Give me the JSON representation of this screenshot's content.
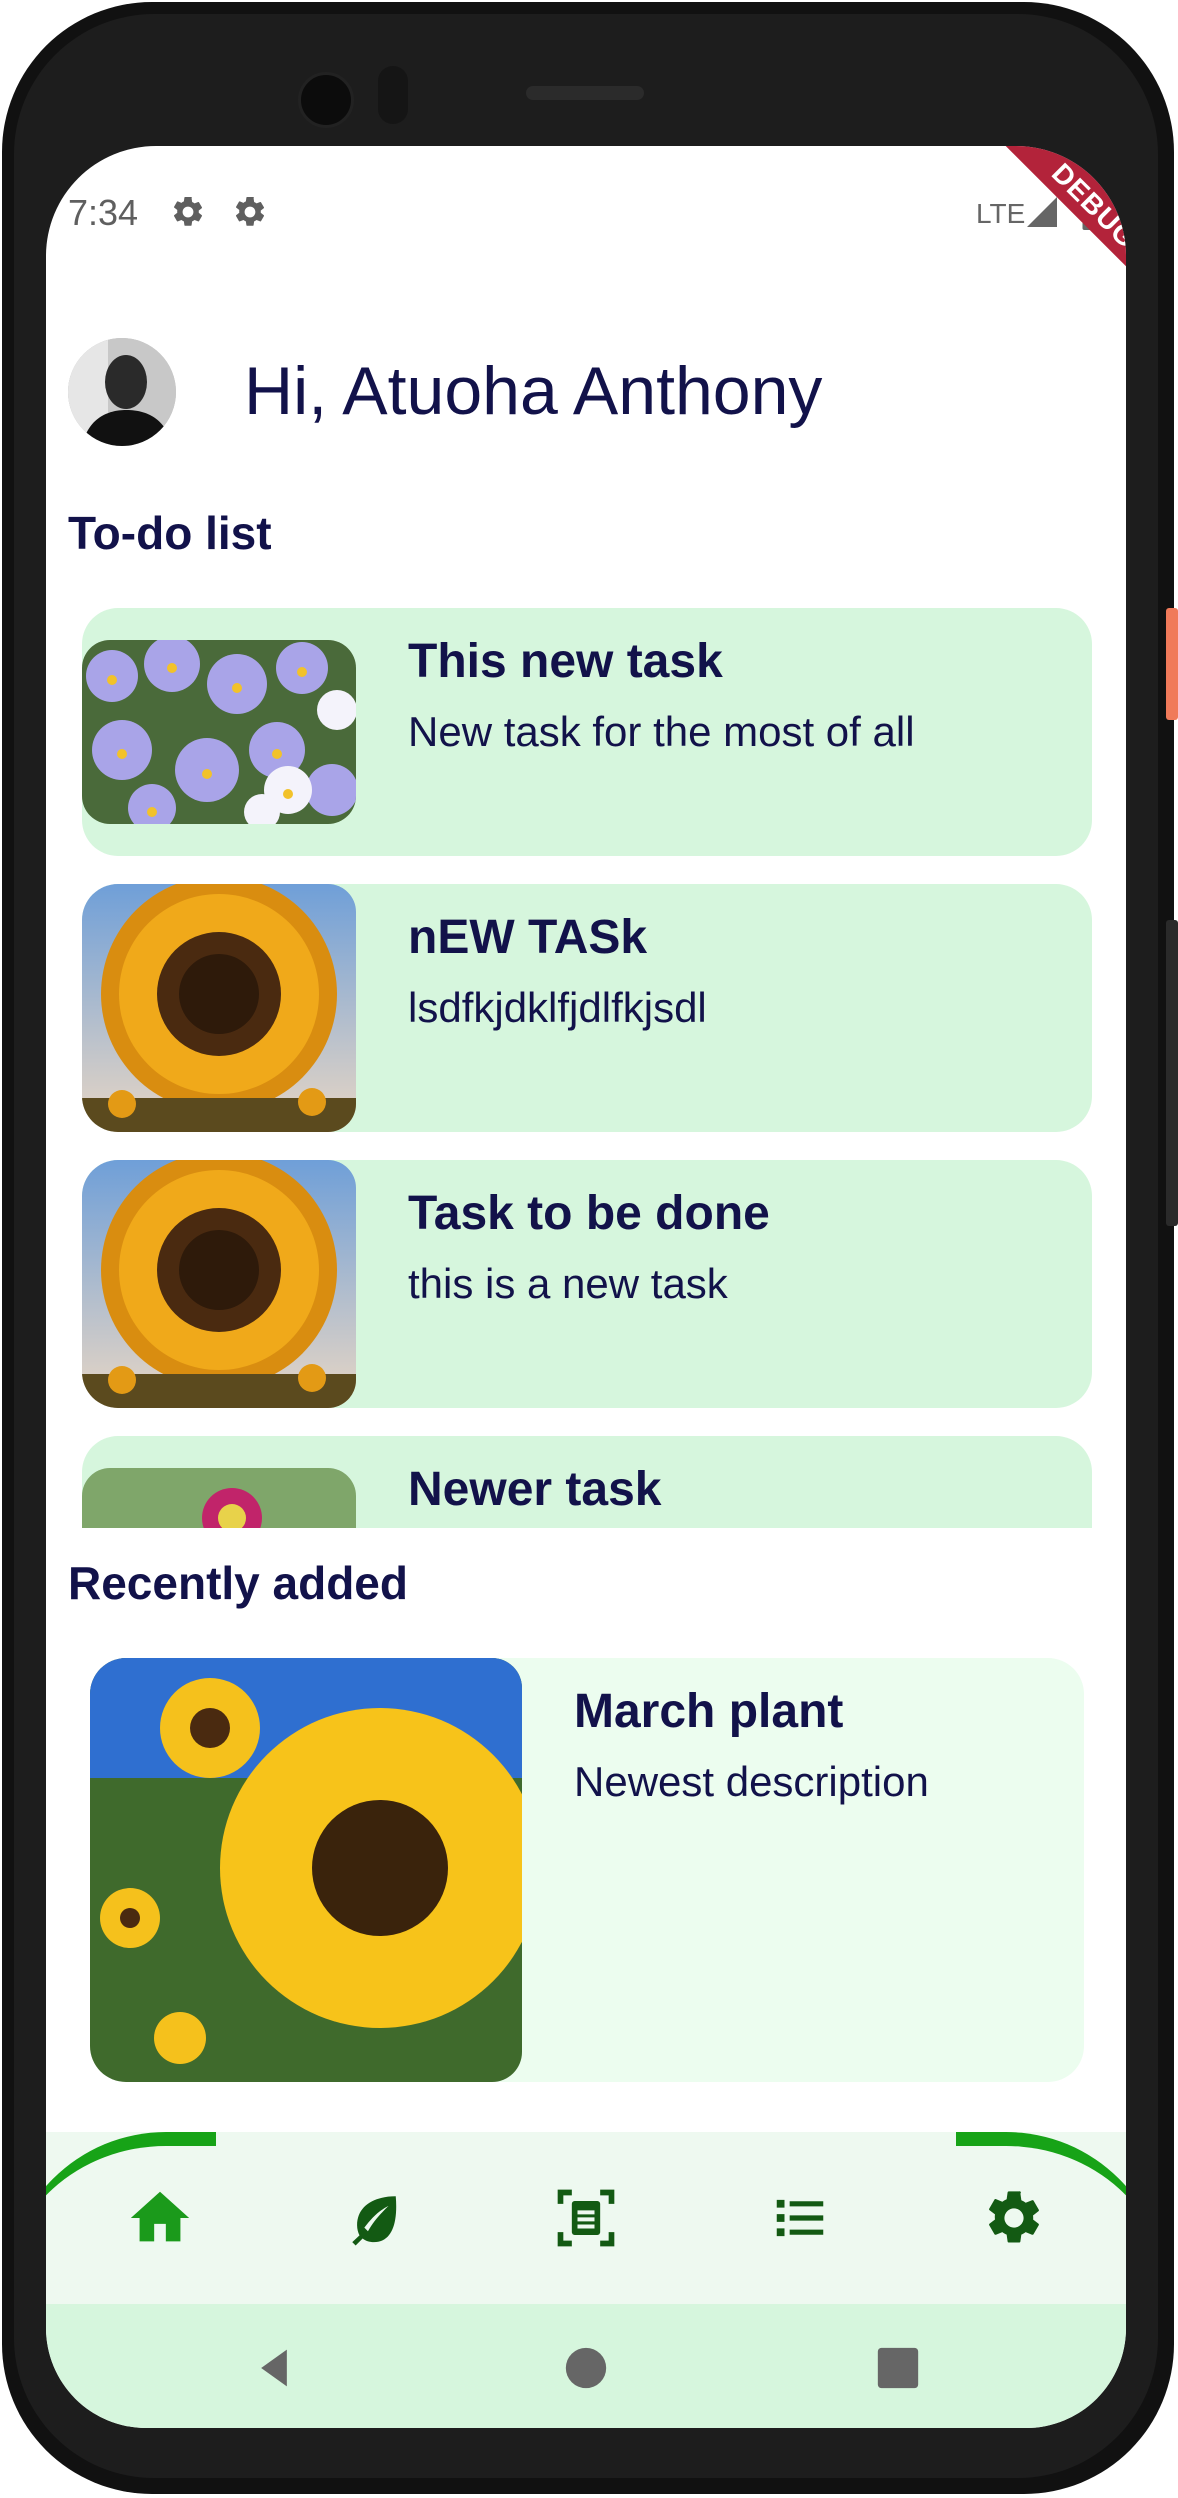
{
  "status_bar": {
    "time": "7:34",
    "network": "LTE",
    "debug_banner": "DEBUG"
  },
  "header": {
    "greeting": "Hi, Atuoha Anthony"
  },
  "todo": {
    "title": "To-do list",
    "tasks": [
      {
        "title": "This new task",
        "description": "New task for the most of all",
        "image": "pansies-image"
      },
      {
        "title": "nEW TASk",
        "description": "lsdfkjdklfjdlfkjsdl",
        "image": "sunflower-image"
      },
      {
        "title": "Task to be done",
        "description": "this is a new task",
        "image": "sunflower-image"
      },
      {
        "title": "Newer task",
        "description": "",
        "image": "dahlia-image"
      }
    ]
  },
  "recent": {
    "title": "Recently added",
    "item": {
      "title": "March plant",
      "description": "Newest description",
      "image": "sunflowers-image"
    }
  },
  "bottom_nav": {
    "items": [
      {
        "icon": "home-icon",
        "active": true
      },
      {
        "icon": "leaf-icon",
        "active": false
      },
      {
        "icon": "scan-document-icon",
        "active": false
      },
      {
        "icon": "list-icon",
        "active": false
      },
      {
        "icon": "settings-icon",
        "active": false
      }
    ]
  },
  "colors": {
    "primary_text": "#12124a",
    "card_bg": "#d6f6dd",
    "recent_card_bg": "#ecfdef",
    "nav_active": "#1b9a1b",
    "nav_icon": "#135a13",
    "nav_curve": "#17a317",
    "debug_banner": "#b3233a"
  }
}
